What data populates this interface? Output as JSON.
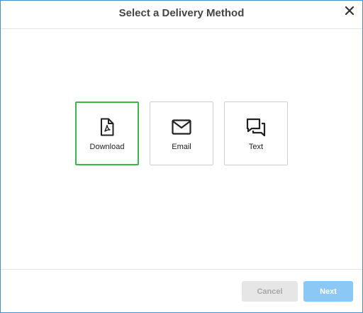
{
  "dialog": {
    "title": "Select a Delivery Method",
    "close_icon": "close-icon"
  },
  "options": [
    {
      "label": "Download",
      "icon": "pdf-file-icon",
      "selected": true
    },
    {
      "label": "Email",
      "icon": "envelope-icon",
      "selected": false
    },
    {
      "label": "Text",
      "icon": "chat-bubbles-icon",
      "selected": false
    }
  ],
  "footer": {
    "cancel_label": "Cancel",
    "next_label": "Next"
  },
  "colors": {
    "selected_border": "#3cb64a",
    "next_button": "#8cc8f5",
    "cancel_button": "#e6e6e6",
    "dialog_border": "#4a8fc8"
  }
}
